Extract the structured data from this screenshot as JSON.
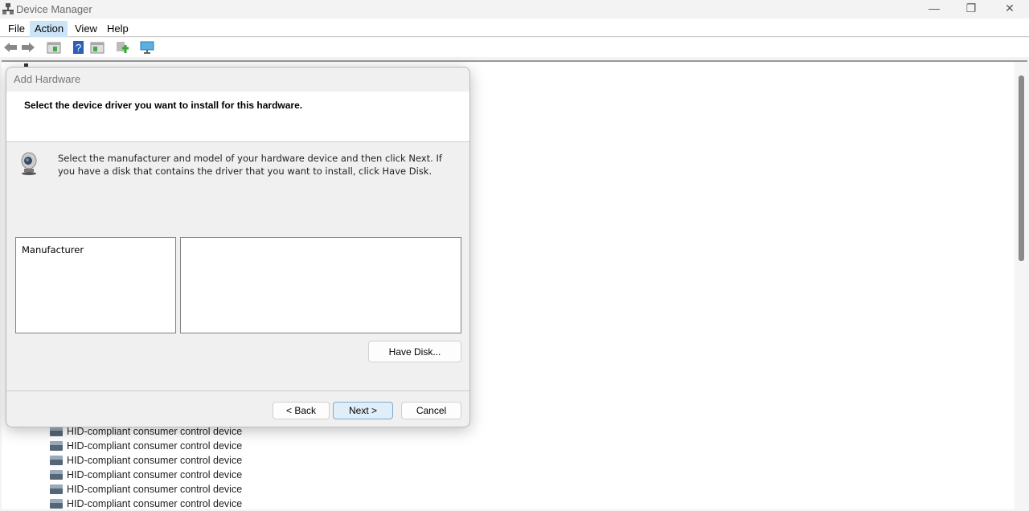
{
  "window": {
    "title": "Device Manager",
    "minimize": "—",
    "restore": "❐",
    "close": "✕"
  },
  "menu": [
    {
      "label": "File"
    },
    {
      "label": "Action"
    },
    {
      "label": "View"
    },
    {
      "label": "Help"
    }
  ],
  "toolbar": [
    "back-icon",
    "forward-icon",
    "show-hide-console-tree-icon",
    "help-icon",
    "action-pane-icon",
    "update-driver-icon",
    "scan-hardware-icon"
  ],
  "tree": {
    "items": [
      "HID-compliant consumer control device",
      "HID-compliant consumer control device",
      "HID-compliant consumer control device",
      "HID-compliant consumer control device",
      "HID-compliant consumer control device",
      "HID-compliant consumer control device"
    ]
  },
  "dialog": {
    "title": "Add Hardware",
    "heading": "Select the device driver you want to install for this hardware.",
    "description": "Select the manufacturer and model of your hardware device and then click Next. If you have a disk that contains the driver that you want to install, click Have Disk.",
    "manufacturer_header": "Manufacturer",
    "have_disk": "Have Disk...",
    "back": "< Back",
    "next": "Next >",
    "cancel": "Cancel"
  }
}
